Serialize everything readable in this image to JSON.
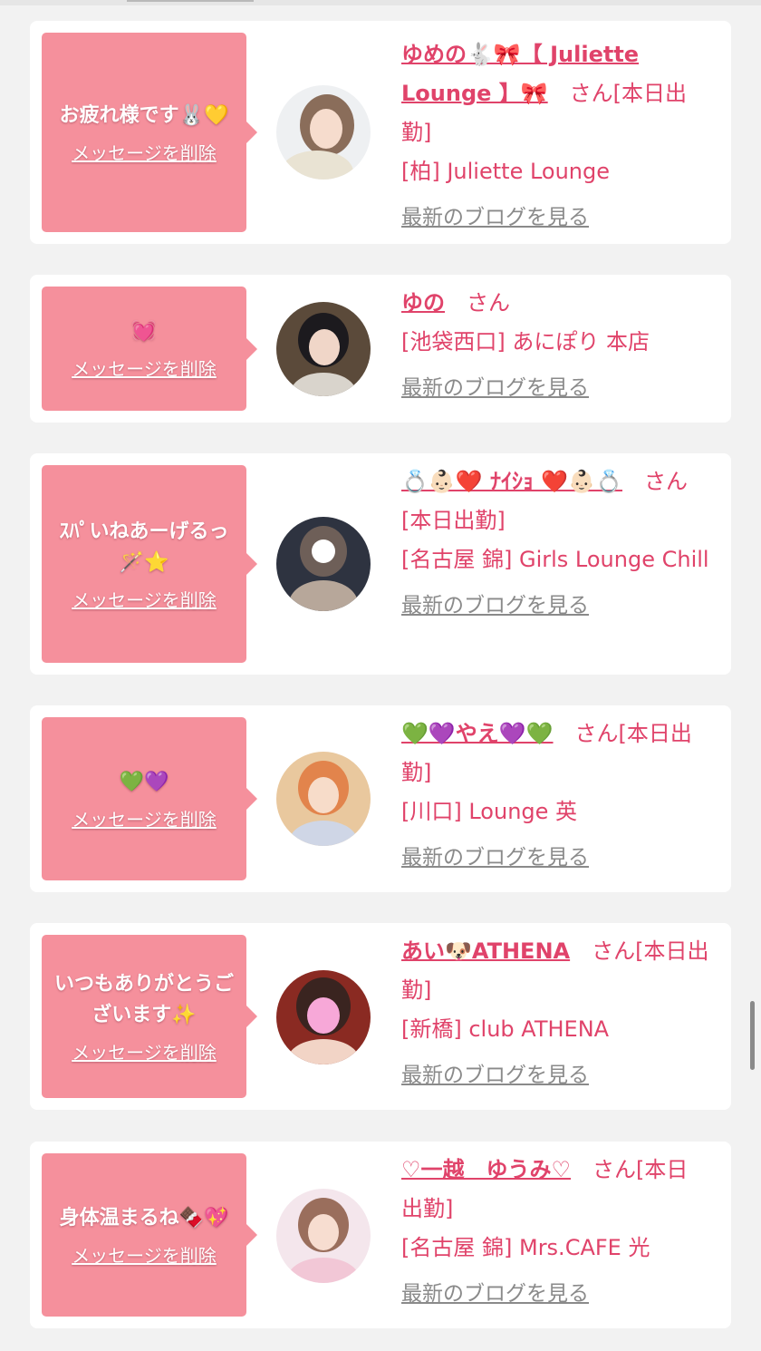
{
  "colors": {
    "accent": "#e0436a",
    "bubble": "#f5909c",
    "link_gray": "#8a8a8a",
    "background": "#f2f2f2"
  },
  "items": [
    {
      "message": "お疲れ様です🐰💛",
      "delete_label": "メッセージを削除",
      "name": "ゆめの🐇🎀【 Juliette Lounge 】🎀",
      "suffix": "　さん[本日出勤]",
      "shop": "[柏] Juliette Lounge",
      "blog_label": "最新のブログを見る"
    },
    {
      "message": "💓",
      "delete_label": "メッセージを削除",
      "name": "ゆの",
      "suffix": "　さん",
      "shop": "[池袋西口] あにぽり 本店",
      "blog_label": "最新のブログを見る"
    },
    {
      "message": "ｽﾊﾟいねあーげるっ🪄⭐️",
      "delete_label": "メッセージを削除",
      "name": "💍👶🏻❤️ ﾅｲｼｮ ❤️👶🏻💍",
      "suffix": "　さん[本日出勤]",
      "shop": "[名古屋 錦] Girls Lounge Chill",
      "blog_label": "最新のブログを見る"
    },
    {
      "message": "💚💜",
      "delete_label": "メッセージを削除",
      "name": "💚💜やえ💜💚",
      "suffix": "　さん[本日出勤]",
      "shop": "[川口] Lounge 英",
      "blog_label": "最新のブログを見る"
    },
    {
      "message": "いつもありがとうございます✨",
      "delete_label": "メッセージを削除",
      "name": "あい🐶ATHENA",
      "suffix": "　さん[本日出勤]",
      "shop": "[新橋] club ATHENA",
      "blog_label": "最新のブログを見る"
    },
    {
      "message": "身体温まるね🍫💖",
      "delete_label": "メッセージを削除",
      "name": "♡一越　ゆうみ♡",
      "suffix": "　さん[本日出勤]",
      "shop": "[名古屋 錦] Mrs.CAFE 光",
      "blog_label": "最新のブログを見る"
    }
  ]
}
